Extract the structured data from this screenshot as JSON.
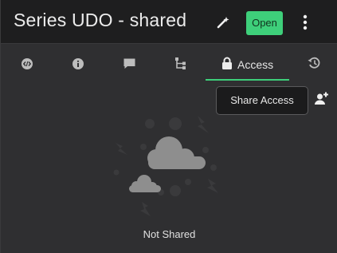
{
  "header": {
    "title": "Series UDO - shared",
    "open_label": "Open"
  },
  "tabs": [
    {
      "id": "code",
      "icon": "code-icon"
    },
    {
      "id": "info",
      "icon": "info-icon"
    },
    {
      "id": "comments",
      "icon": "comment-icon"
    },
    {
      "id": "lineage",
      "icon": "lineage-icon"
    },
    {
      "id": "access",
      "icon": "lock-icon",
      "label": "Access",
      "active": true
    },
    {
      "id": "history",
      "icon": "history-icon"
    }
  ],
  "tooltip": {
    "text": "Share Access"
  },
  "empty_state": {
    "message": "Not Shared"
  },
  "colors": {
    "accent": "#3ecf7a",
    "header_bg": "#1e1e1f",
    "panel_bg": "#2f2f31"
  }
}
